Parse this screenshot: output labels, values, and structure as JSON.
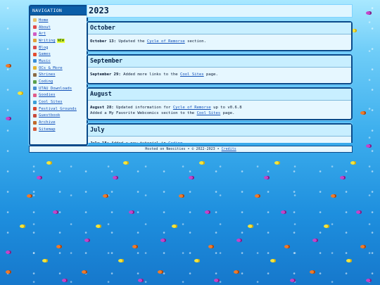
{
  "nav": {
    "heading": "NAVIGATION",
    "items": [
      {
        "label": "Home",
        "icon": "page-icon",
        "color": "#e8c36a"
      },
      {
        "label": "About",
        "icon": "ribbon-icon",
        "color": "#e04c4c"
      },
      {
        "label": "Art",
        "icon": "palette-icon",
        "color": "#d05cc4"
      },
      {
        "label": "Writing",
        "icon": "pencil-icon",
        "color": "#e0a23a",
        "badge": "NEW"
      },
      {
        "label": "Blog",
        "icon": "note-icon",
        "color": "#d84a4a"
      },
      {
        "label": "Games",
        "icon": "controller-icon",
        "color": "#e34c2f"
      },
      {
        "label": "Music",
        "icon": "music-icon",
        "color": "#3a8fd8"
      },
      {
        "label": "OCs & More",
        "icon": "star-icon",
        "color": "#e3b530"
      },
      {
        "label": "Shrines",
        "icon": "shrine-icon",
        "color": "#8a6a44"
      },
      {
        "label": "Coding",
        "icon": "code-icon",
        "color": "#5aa04a"
      },
      {
        "label": "UTAU Downloads",
        "icon": "download-icon",
        "color": "#4a8fd0"
      },
      {
        "label": "Goodies",
        "icon": "gift-icon",
        "color": "#e05c8a"
      },
      {
        "label": "Cool Sites",
        "icon": "globe-icon",
        "color": "#3a9fd8"
      },
      {
        "label": "Festival Grounds",
        "icon": "tent-icon",
        "color": "#d8462f"
      },
      {
        "label": "Guestbook",
        "icon": "book-icon",
        "color": "#c84a3a"
      },
      {
        "label": "Archive",
        "icon": "box-icon",
        "color": "#c06a2a"
      },
      {
        "label": "Sitemap",
        "icon": "map-icon",
        "color": "#d85a3a"
      }
    ]
  },
  "page": {
    "title": "2023"
  },
  "updates": [
    {
      "month": "October",
      "entries": [
        {
          "date": "October 13:",
          "pre": " Updated the ",
          "link": "Cycle of Remorse",
          "post": " section."
        }
      ]
    },
    {
      "month": "September",
      "entries": [
        {
          "date": "September 29:",
          "pre": " Added more links to the ",
          "link": "Cool Sites",
          "post": " page."
        }
      ]
    },
    {
      "month": "August",
      "entries": [
        {
          "date": "August 28:",
          "pre": " Updated information for ",
          "link": "Cycle of Remorse",
          "post": " up to v0.6.8"
        },
        {
          "date": "",
          "pre": "Added a My Favorite Webcomics section to the ",
          "link": "Cool Sites",
          "post": " page."
        }
      ]
    },
    {
      "month": "July",
      "entries": [
        {
          "date": "July 18:",
          "pre": " Added a new tutorial in ",
          "link": "Coding",
          "post": ""
        }
      ]
    }
  ],
  "footer": {
    "text": "Hosted on Neocities • © 2022-2023 • ",
    "link": "Credits"
  },
  "colors": {
    "panel": "#e6f7ff",
    "border": "#0a4a8a",
    "link": "#1150b8",
    "badge": "#e8ff3a"
  }
}
